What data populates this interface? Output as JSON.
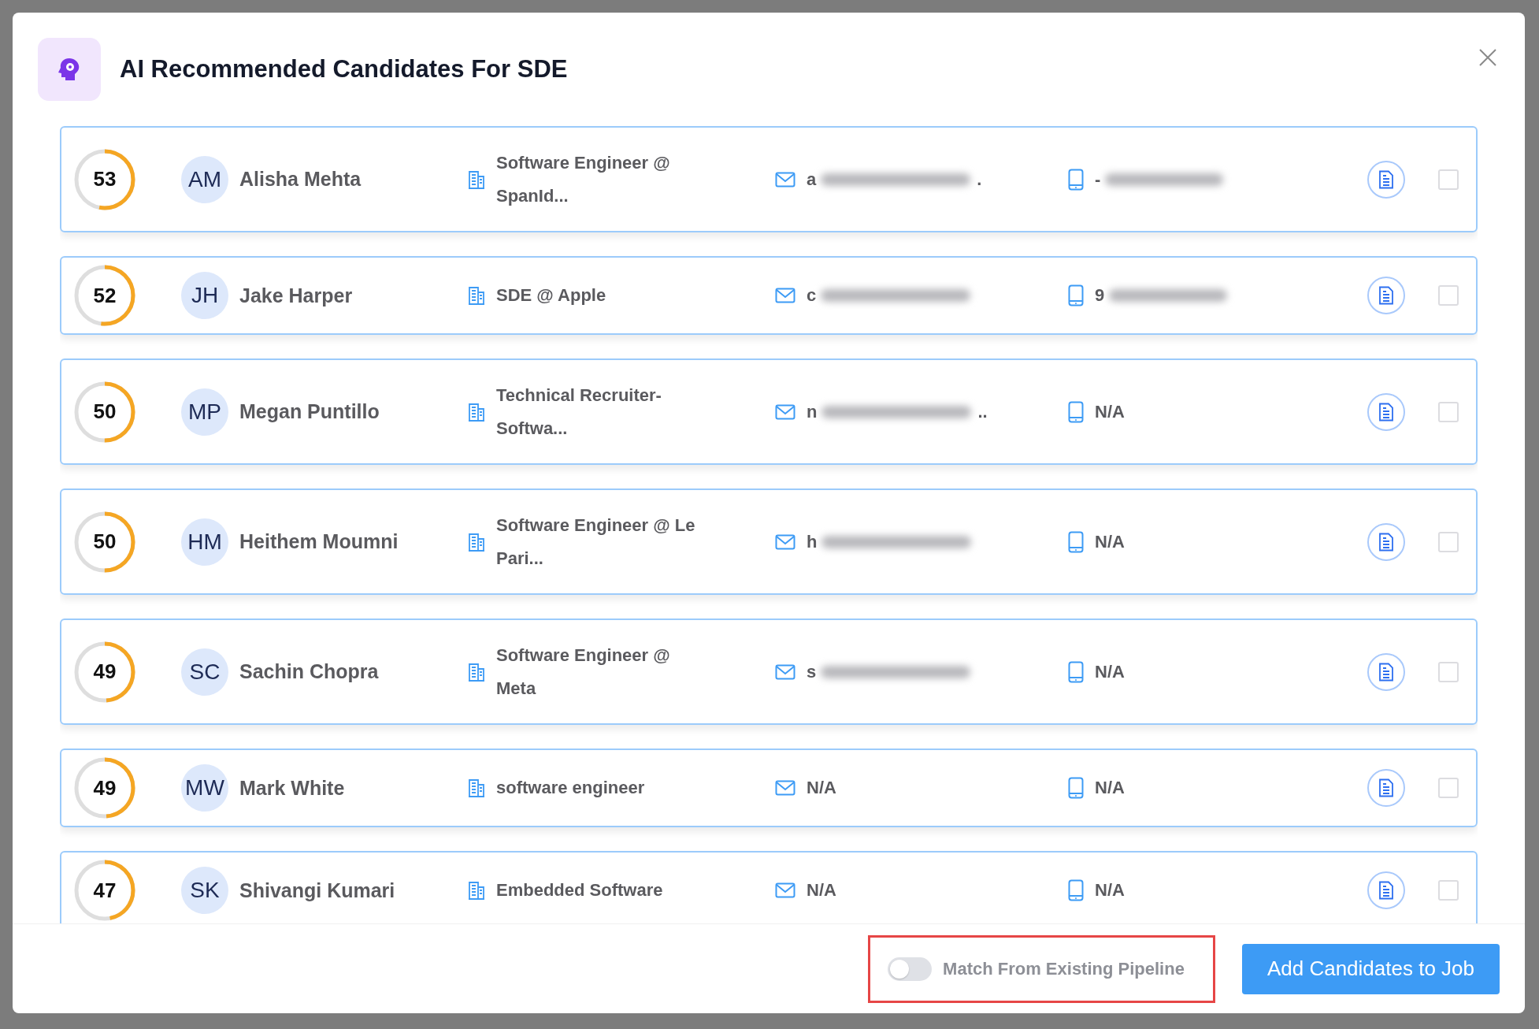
{
  "dialog": {
    "title": "AI Recommended Candidates For SDE"
  },
  "candidates": [
    {
      "score": "53",
      "level": 0.53,
      "initials": "AM",
      "name": "Alisha Mehta",
      "headline": "Software Engineer @ SpanId...",
      "email": {
        "text": "a",
        "blurred": true,
        "tail": "."
      },
      "phone": {
        "text": "-",
        "blurred": true
      },
      "checked": false
    },
    {
      "score": "52",
      "level": 0.52,
      "initials": "JH",
      "name": "Jake Harper",
      "headline": "SDE @ Apple",
      "email": {
        "text": "c",
        "blurred": true
      },
      "phone": {
        "text": "9",
        "blurred": true
      },
      "checked": false
    },
    {
      "score": "50",
      "level": 0.5,
      "initials": "MP",
      "name": "Megan Puntillo",
      "headline": "Technical Recruiter- Softwa...",
      "email": {
        "text": "n",
        "blurred": true,
        "tail": ".."
      },
      "phone": {
        "text": "N/A"
      },
      "checked": false
    },
    {
      "score": "50",
      "level": 0.5,
      "initials": "HM",
      "name": "Heithem Moumni",
      "headline": "Software Engineer @ Le Pari...",
      "email": {
        "text": "h",
        "blurred": true
      },
      "phone": {
        "text": "N/A"
      },
      "checked": false
    },
    {
      "score": "49",
      "level": 0.49,
      "initials": "SC",
      "name": "Sachin Chopra",
      "headline": "Software Engineer @ Meta",
      "email": {
        "text": "s",
        "blurred": true
      },
      "phone": {
        "text": "N/A"
      },
      "checked": false
    },
    {
      "score": "49",
      "level": 0.49,
      "initials": "MW",
      "name": "Mark White",
      "headline": "software engineer",
      "email": {
        "text": "N/A"
      },
      "phone": {
        "text": "N/A"
      },
      "checked": false
    },
    {
      "score": "47",
      "level": 0.47,
      "initials": "SK",
      "name": "Shivangi Kumari",
      "headline": "Embedded Software",
      "email": {
        "text": "N/A"
      },
      "phone": {
        "text": "N/A"
      },
      "checked": false
    }
  ],
  "footer": {
    "toggle": {
      "label": "Match From Existing Pipeline",
      "on": false,
      "highlighted": true
    },
    "primary_button": "Add Candidates to Job"
  }
}
